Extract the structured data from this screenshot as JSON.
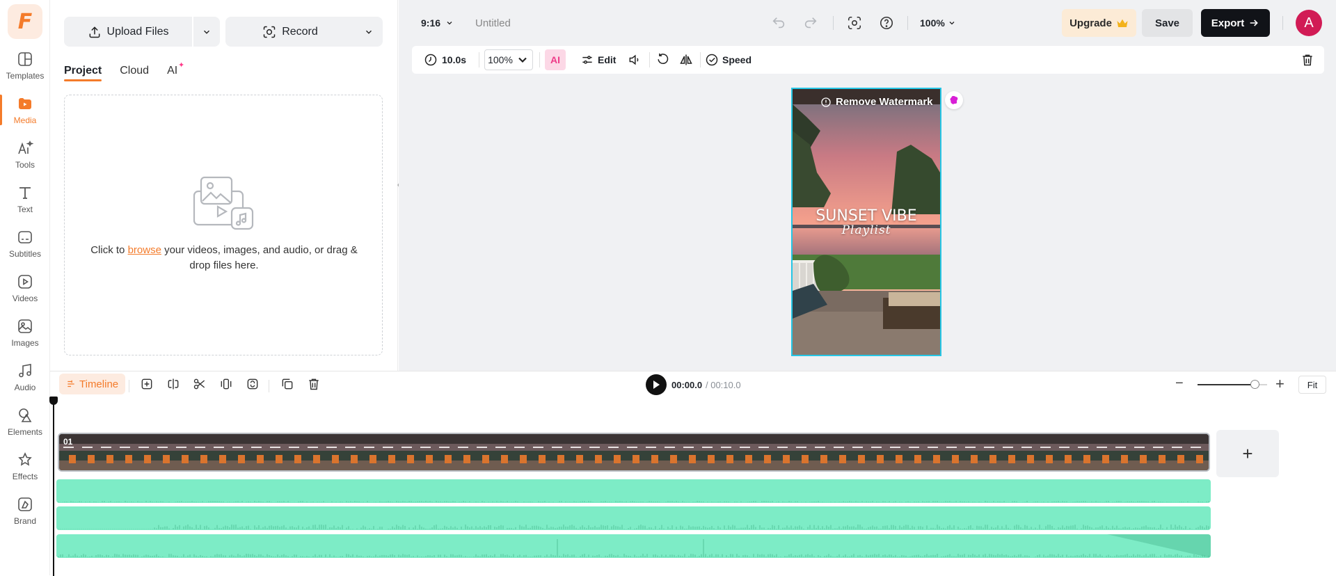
{
  "sidebar": {
    "logo_letter": "F",
    "items": [
      {
        "label": "Templates",
        "icon": "templates-icon"
      },
      {
        "label": "Media",
        "icon": "media-icon",
        "active": true
      },
      {
        "label": "Tools",
        "icon": "ai-tools-icon"
      },
      {
        "label": "Text",
        "icon": "text-icon"
      },
      {
        "label": "Subtitles",
        "icon": "subtitles-icon"
      },
      {
        "label": "Videos",
        "icon": "videos-icon"
      },
      {
        "label": "Images",
        "icon": "images-icon"
      },
      {
        "label": "Audio",
        "icon": "audio-icon"
      },
      {
        "label": "Elements",
        "icon": "elements-icon"
      },
      {
        "label": "Effects",
        "icon": "effects-icon"
      },
      {
        "label": "Brand",
        "icon": "brand-icon"
      }
    ]
  },
  "panel": {
    "upload_label": "Upload Files",
    "record_label": "Record",
    "tabs": [
      {
        "label": "Project",
        "active": true
      },
      {
        "label": "Cloud"
      },
      {
        "label": "AI",
        "badge": "✦"
      }
    ],
    "drop_prefix": "Click to ",
    "drop_link": "browse",
    "drop_suffix": " your videos, images, and audio, or drag & drop files here."
  },
  "topbar": {
    "aspect_ratio": "9:16",
    "project_name": "Untitled",
    "zoom": "100%",
    "upgrade_label": "Upgrade",
    "save_label": "Save",
    "export_label": "Export",
    "avatar_letter": "A"
  },
  "edit_toolbar": {
    "duration": "10.0s",
    "scale": "100%",
    "ai_label": "AI",
    "edit_label": "Edit",
    "speed_label": "Speed"
  },
  "canvas": {
    "watermark_label": "Remove Watermark",
    "title_main": "SUNSET VIBE",
    "title_sub": "Playlist"
  },
  "timeline": {
    "tag_label": "Timeline",
    "time_current": "00:00.0",
    "time_total": "/ 00:10.0",
    "fit_label": "Fit",
    "zoom_level": 0.82,
    "clip_number": "01"
  },
  "colors": {
    "accent": "#f47b2a",
    "selection": "#25c6e5",
    "audio": "#7decc6",
    "export_bg": "#111318",
    "avatar": "#d11b55"
  }
}
